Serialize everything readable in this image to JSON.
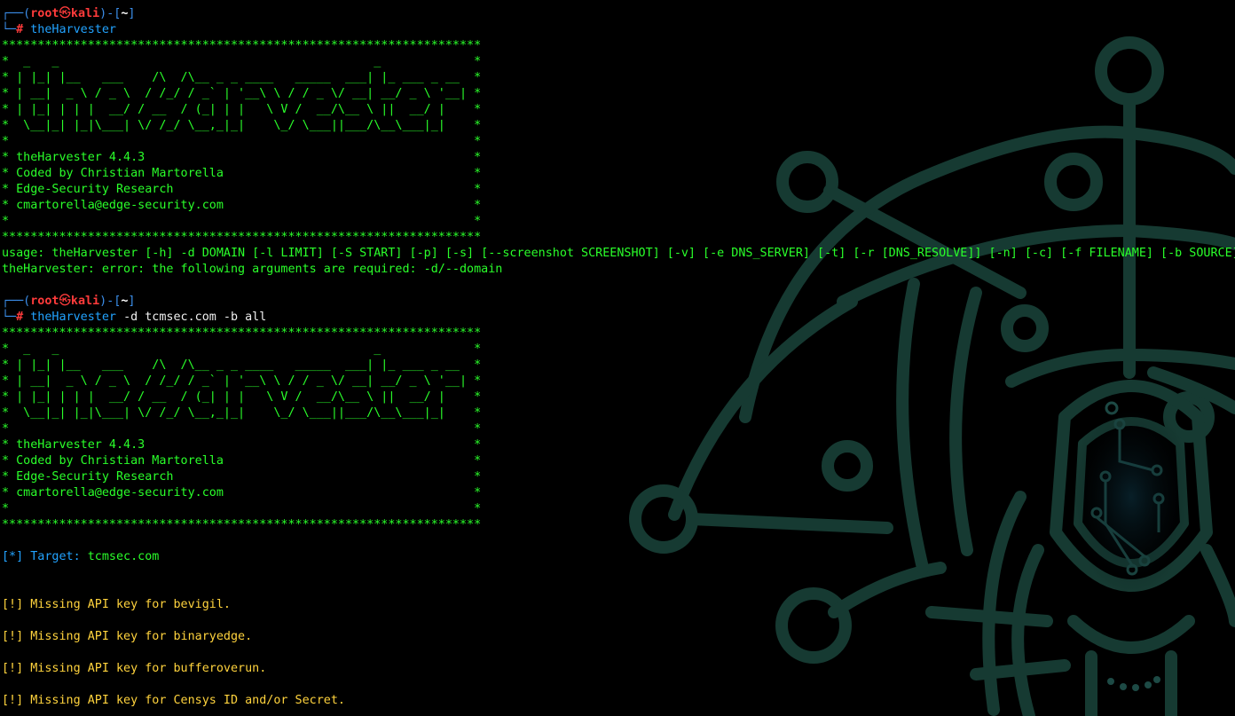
{
  "prompt": {
    "top_left": "┌──(",
    "user": "root",
    "skull": "㉿",
    "host": "kali",
    "mid": ")-[",
    "dir": "~",
    "end": "]",
    "bottom_left": "└─",
    "hash": "#"
  },
  "commands": [
    {
      "name": "theHarvester",
      "args": ""
    },
    {
      "name": "theHarvester",
      "args": "-d tcmsec.com -b all"
    }
  ],
  "banner": {
    "stars": "*******************************************************************",
    "art": [
      "*  _   _                                            _             *",
      "* | |_| |__   ___    /\\  /\\__ _ _ ____   _____  ___| |_ ___ _ __  *",
      "* | __|  _ \\ / _ \\  / /_/ / _` | '__\\ \\ / / _ \\/ __| __/ _ \\ '__| *",
      "* | |_| | | |  __/ / __  / (_| | |   \\ V /  __/\\__ \\ ||  __/ |    *",
      "*  \\__|_| |_|\\___| \\/ /_/ \\__,_|_|    \\_/ \\___||___/\\__\\___|_|    *",
      "*                                                                 *"
    ],
    "info": [
      "* theHarvester 4.4.3                                              *",
      "* Coded by Christian Martorella                                   *",
      "* Edge-Security Research                                          *",
      "* cmartorella@edge-security.com                                   *",
      "*                                                                 *"
    ]
  },
  "usage": "usage: theHarvester [-h] -d DOMAIN [-l LIMIT] [-S START] [-p] [-s] [--screenshot SCREENSHOT] [-v] [-e DNS_SERVER] [-t] [-r [DNS_RESOLVE]] [-n] [-c] [-f FILENAME] [-b SOURCE]",
  "error": "theHarvester: error: the following arguments are required: -d/--domain",
  "target": {
    "label": "[*] Target: ",
    "value": "tcmsec.com"
  },
  "warnings": [
    "[!] Missing API key for bevigil.",
    "[!] Missing API key for binaryedge.",
    "[!] Missing API key for bufferoverun.",
    "[!] Missing API key for Censys ID and/or Secret."
  ],
  "colors": {
    "background": "#000000",
    "green": "#2aff2a",
    "blue": "#22a3ff",
    "red": "#ff3b3b",
    "yellow": "#ffd33d",
    "art": "#163a32"
  },
  "icons": [
    "kali-dragon-web-art"
  ]
}
